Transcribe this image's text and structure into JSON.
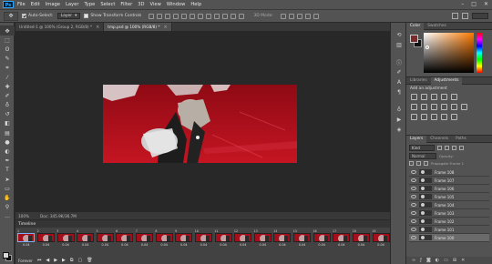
{
  "app": {
    "logo": "Ps"
  },
  "menu": [
    "File",
    "Edit",
    "Image",
    "Layer",
    "Type",
    "Select",
    "Filter",
    "3D",
    "View",
    "Window",
    "Help"
  ],
  "window_controls": [
    "–",
    "□",
    "✕"
  ],
  "options": {
    "auto_select_label": "Auto-Select:",
    "auto_select_value": "Layer",
    "transform_label": "Show Transform Controls",
    "mode_3d": "3D Mode:"
  },
  "tabs": [
    {
      "label": "Untitled-1 @ 100% (Group 2, RGB/8) *",
      "active": false
    },
    {
      "label": "tmp.psd @ 100% (RGB/8) *",
      "active": true
    }
  ],
  "status": {
    "zoom": "100%",
    "doc": "Doc: 345.9K/36.7M"
  },
  "timeline": {
    "title": "Timeline",
    "frames": [
      {
        "num": "1",
        "delay": "0.04"
      },
      {
        "num": "2",
        "delay": "0.04"
      },
      {
        "num": "3",
        "delay": "0.04"
      },
      {
        "num": "4",
        "delay": "0.04"
      },
      {
        "num": "5",
        "delay": "0.04"
      },
      {
        "num": "6",
        "delay": "0.04"
      },
      {
        "num": "7",
        "delay": "0.04"
      },
      {
        "num": "8",
        "delay": "0.04"
      },
      {
        "num": "9",
        "delay": "0.04"
      },
      {
        "num": "10",
        "delay": "0.04"
      },
      {
        "num": "11",
        "delay": "0.04"
      },
      {
        "num": "12",
        "delay": "0.04"
      },
      {
        "num": "13",
        "delay": "0.04"
      },
      {
        "num": "14",
        "delay": "0.04"
      },
      {
        "num": "15",
        "delay": "0.04"
      },
      {
        "num": "16",
        "delay": "0.04"
      },
      {
        "num": "17",
        "delay": "0.04"
      },
      {
        "num": "18",
        "delay": "0.04"
      },
      {
        "num": "19",
        "delay": "0.04"
      }
    ],
    "loop": "Forever"
  },
  "panels": {
    "color_tabs": [
      "Color",
      "Swatches"
    ],
    "adj_tabs": [
      "Libraries",
      "Adjustments"
    ],
    "adj_label": "Add an adjustment",
    "layer_tabs": [
      "Layers",
      "Channels",
      "Paths"
    ],
    "kind": "Kind",
    "mode": "Normal",
    "opacity": "Opacity:",
    "propagate": "Propagate Frame 1",
    "layers": [
      {
        "name": "Frame 108",
        "sel": false
      },
      {
        "name": "Frame 107",
        "sel": false
      },
      {
        "name": "Frame 106",
        "sel": false
      },
      {
        "name": "Frame 105",
        "sel": false
      },
      {
        "name": "Frame 104",
        "sel": false
      },
      {
        "name": "Frame 103",
        "sel": false
      },
      {
        "name": "Frame 102",
        "sel": false
      },
      {
        "name": "Frame 101",
        "sel": false
      },
      {
        "name": "Frame 100",
        "sel": true
      }
    ]
  },
  "colors": {
    "accent": "#31a8ff",
    "canvas_red": "#b40d1a"
  }
}
